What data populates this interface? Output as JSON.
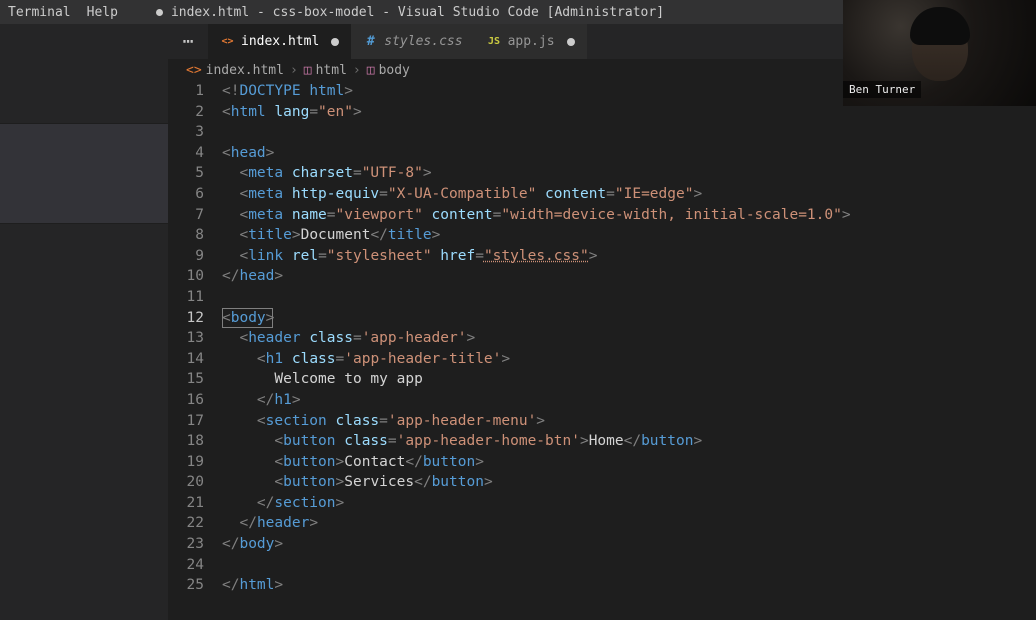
{
  "titlebar": {
    "menu": {
      "terminal": "Terminal",
      "help": "Help"
    },
    "window_title": "index.html - css-box-model - Visual Studio Code [Administrator]"
  },
  "tabs": [
    {
      "label": "index.html",
      "icon": "<>",
      "icon_color": "#e37933",
      "active": true,
      "dirty": true
    },
    {
      "label": "styles.css",
      "icon": "#",
      "icon_color": "#529bd4",
      "active": false,
      "italic": true
    },
    {
      "label": "app.js",
      "icon": "JS",
      "icon_color": "#cbcb41",
      "active": false,
      "dirty": true
    }
  ],
  "breadcrumb": {
    "parts": [
      {
        "icon": "<>",
        "icon_color": "#e37933",
        "text": "index.html"
      },
      {
        "icon": "◫",
        "icon_color": "#c978a8",
        "text": "html"
      },
      {
        "icon": "◫",
        "icon_color": "#c978a8",
        "text": "body"
      }
    ]
  },
  "camera": {
    "name_label": "Ben Turner"
  },
  "editor": {
    "current_line": 12,
    "lines": [
      {
        "n": 1,
        "seg": [
          [
            "punct",
            "<"
          ],
          [
            "punct",
            "!"
          ],
          [
            "doctype",
            "DOCTYPE "
          ],
          [
            "tag",
            "html"
          ],
          [
            "punct",
            ">"
          ]
        ]
      },
      {
        "n": 2,
        "seg": [
          [
            "punct",
            "<"
          ],
          [
            "tag",
            "html "
          ],
          [
            "attr",
            "lang"
          ],
          [
            "punct",
            "="
          ],
          [
            "str",
            "\"en\""
          ],
          [
            "punct",
            ">"
          ]
        ]
      },
      {
        "n": 3,
        "seg": []
      },
      {
        "n": 4,
        "seg": [
          [
            "punct",
            "<"
          ],
          [
            "tag",
            "head"
          ],
          [
            "punct",
            ">"
          ]
        ]
      },
      {
        "n": 5,
        "seg": [
          [
            "text",
            "  "
          ],
          [
            "punct",
            "<"
          ],
          [
            "tag",
            "meta "
          ],
          [
            "attr",
            "charset"
          ],
          [
            "punct",
            "="
          ],
          [
            "str",
            "\"UTF-8\""
          ],
          [
            "punct",
            ">"
          ]
        ]
      },
      {
        "n": 6,
        "seg": [
          [
            "text",
            "  "
          ],
          [
            "punct",
            "<"
          ],
          [
            "tag",
            "meta "
          ],
          [
            "attr",
            "http-equiv"
          ],
          [
            "punct",
            "="
          ],
          [
            "str",
            "\"X-UA-Compatible\" "
          ],
          [
            "attr",
            "content"
          ],
          [
            "punct",
            "="
          ],
          [
            "str",
            "\"IE=edge\""
          ],
          [
            "punct",
            ">"
          ]
        ]
      },
      {
        "n": 7,
        "seg": [
          [
            "text",
            "  "
          ],
          [
            "punct",
            "<"
          ],
          [
            "tag",
            "meta "
          ],
          [
            "attr",
            "name"
          ],
          [
            "punct",
            "="
          ],
          [
            "str",
            "\"viewport\" "
          ],
          [
            "attr",
            "content"
          ],
          [
            "punct",
            "="
          ],
          [
            "str",
            "\"width=device-width, initial-scale=1.0\""
          ],
          [
            "punct",
            ">"
          ]
        ]
      },
      {
        "n": 8,
        "seg": [
          [
            "text",
            "  "
          ],
          [
            "punct",
            "<"
          ],
          [
            "tag",
            "title"
          ],
          [
            "punct",
            ">"
          ],
          [
            "text",
            "Document"
          ],
          [
            "punct",
            "</"
          ],
          [
            "tag",
            "title"
          ],
          [
            "punct",
            ">"
          ]
        ]
      },
      {
        "n": 9,
        "seg": [
          [
            "text",
            "  "
          ],
          [
            "punct",
            "<"
          ],
          [
            "tag",
            "link "
          ],
          [
            "attr",
            "rel"
          ],
          [
            "punct",
            "="
          ],
          [
            "str",
            "\"stylesheet\" "
          ],
          [
            "attr",
            "href"
          ],
          [
            "punct",
            "="
          ],
          [
            "stru",
            "\"styles.css\""
          ],
          [
            "punct",
            ">"
          ]
        ]
      },
      {
        "n": 10,
        "seg": [
          [
            "punct",
            "</"
          ],
          [
            "tag",
            "head"
          ],
          [
            "punct",
            ">"
          ]
        ]
      },
      {
        "n": 11,
        "seg": []
      },
      {
        "n": 12,
        "seg": [
          [
            "punct",
            "<"
          ],
          [
            "tag",
            "body"
          ],
          [
            "punct",
            ">"
          ]
        ],
        "selection": true
      },
      {
        "n": 13,
        "seg": [
          [
            "text",
            "  "
          ],
          [
            "punct",
            "<"
          ],
          [
            "tag",
            "header "
          ],
          [
            "attr",
            "class"
          ],
          [
            "punct",
            "="
          ],
          [
            "str",
            "'app-header'"
          ],
          [
            "punct",
            ">"
          ]
        ]
      },
      {
        "n": 14,
        "seg": [
          [
            "text",
            "    "
          ],
          [
            "punct",
            "<"
          ],
          [
            "tag",
            "h1 "
          ],
          [
            "attr",
            "class"
          ],
          [
            "punct",
            "="
          ],
          [
            "str",
            "'app-header-title'"
          ],
          [
            "punct",
            ">"
          ]
        ]
      },
      {
        "n": 15,
        "seg": [
          [
            "text",
            "      "
          ],
          [
            "text",
            "Welcome to my app"
          ]
        ]
      },
      {
        "n": 16,
        "seg": [
          [
            "text",
            "    "
          ],
          [
            "punct",
            "</"
          ],
          [
            "tag",
            "h1"
          ],
          [
            "punct",
            ">"
          ]
        ]
      },
      {
        "n": 17,
        "seg": [
          [
            "text",
            "    "
          ],
          [
            "punct",
            "<"
          ],
          [
            "tag",
            "section "
          ],
          [
            "attr",
            "class"
          ],
          [
            "punct",
            "="
          ],
          [
            "str",
            "'app-header-menu'"
          ],
          [
            "punct",
            ">"
          ]
        ]
      },
      {
        "n": 18,
        "seg": [
          [
            "text",
            "      "
          ],
          [
            "punct",
            "<"
          ],
          [
            "tag",
            "button "
          ],
          [
            "attr",
            "class"
          ],
          [
            "punct",
            "="
          ],
          [
            "str",
            "'app-header-home-btn'"
          ],
          [
            "punct",
            ">"
          ],
          [
            "text",
            "Home"
          ],
          [
            "punct",
            "</"
          ],
          [
            "tag",
            "button"
          ],
          [
            "punct",
            ">"
          ]
        ]
      },
      {
        "n": 19,
        "seg": [
          [
            "text",
            "      "
          ],
          [
            "punct",
            "<"
          ],
          [
            "tag",
            "button"
          ],
          [
            "punct",
            ">"
          ],
          [
            "text",
            "Contact"
          ],
          [
            "punct",
            "</"
          ],
          [
            "tag",
            "button"
          ],
          [
            "punct",
            ">"
          ]
        ]
      },
      {
        "n": 20,
        "seg": [
          [
            "text",
            "      "
          ],
          [
            "punct",
            "<"
          ],
          [
            "tag",
            "button"
          ],
          [
            "punct",
            ">"
          ],
          [
            "text",
            "Services"
          ],
          [
            "punct",
            "</"
          ],
          [
            "tag",
            "button"
          ],
          [
            "punct",
            ">"
          ]
        ]
      },
      {
        "n": 21,
        "seg": [
          [
            "text",
            "    "
          ],
          [
            "punct",
            "</"
          ],
          [
            "tag",
            "section"
          ],
          [
            "punct",
            ">"
          ]
        ]
      },
      {
        "n": 22,
        "seg": [
          [
            "text",
            "  "
          ],
          [
            "punct",
            "</"
          ],
          [
            "tag",
            "header"
          ],
          [
            "punct",
            ">"
          ]
        ]
      },
      {
        "n": 23,
        "seg": [
          [
            "punct",
            "</"
          ],
          [
            "tag",
            "body"
          ],
          [
            "punct",
            ">"
          ]
        ]
      },
      {
        "n": 24,
        "seg": []
      },
      {
        "n": 25,
        "seg": [
          [
            "punct",
            "</"
          ],
          [
            "tag",
            "html"
          ],
          [
            "punct",
            ">"
          ]
        ]
      }
    ]
  }
}
